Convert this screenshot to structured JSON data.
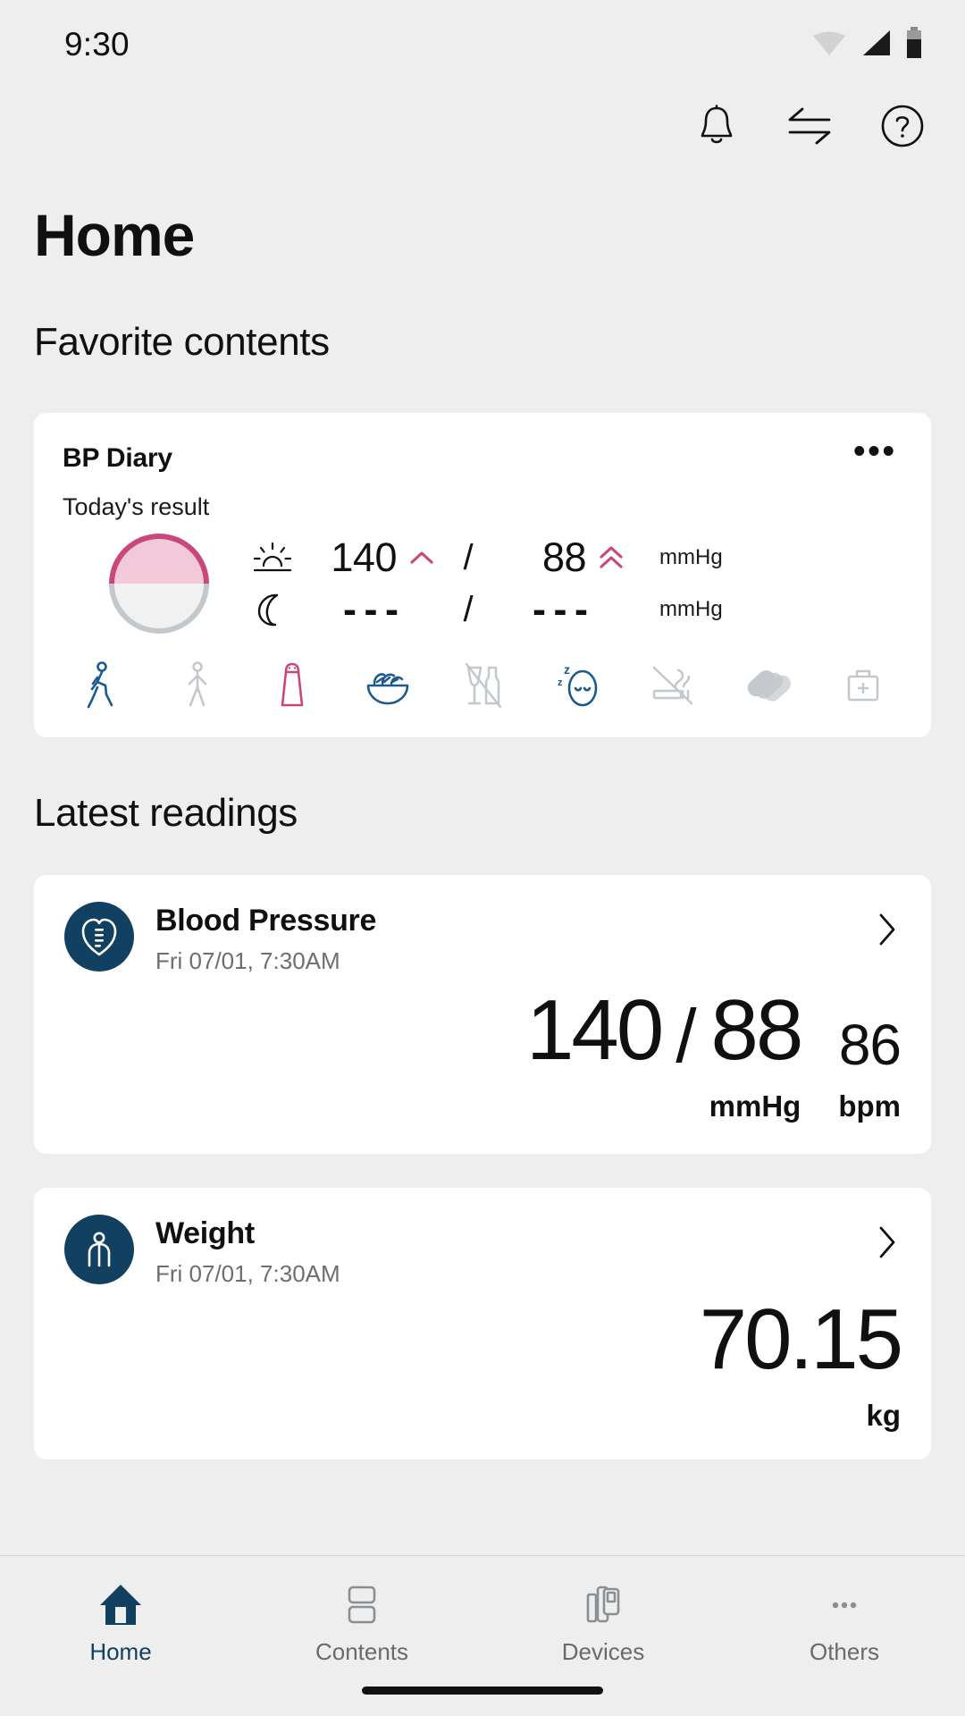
{
  "status_bar": {
    "time": "9:30",
    "icons": [
      "wifi-icon",
      "signal-icon",
      "battery-icon"
    ]
  },
  "header": {
    "title": "Home",
    "actions": [
      {
        "name": "notifications-icon",
        "label": "Notifications"
      },
      {
        "name": "transfer-icon",
        "label": "Transfer"
      },
      {
        "name": "help-icon",
        "label": "Help"
      }
    ]
  },
  "favorites": {
    "section_title": "Favorite contents",
    "bp_diary": {
      "title": "BP Diary",
      "subtitle": "Today's result",
      "more_label": "•••",
      "gauge": {
        "top_color": "#c8487c",
        "top_fill": "#f2c9d8",
        "bottom_color": "#c3c8cc",
        "bottom_fill": "#f1f1f1"
      },
      "rows": [
        {
          "period_icon": "sunrise-icon",
          "systolic": "140",
          "systolic_arrow": "chevron-up-single",
          "separator": "/",
          "diastolic": "88",
          "diastolic_arrow": "chevron-up-double",
          "unit": "mmHg"
        },
        {
          "period_icon": "moon-icon",
          "systolic": "- - -",
          "systolic_arrow": "",
          "separator": "/",
          "diastolic": "- - -",
          "diastolic_arrow": "",
          "unit": "mmHg"
        }
      ],
      "lifestyle_icons": [
        {
          "name": "exercise-icon",
          "state": "active-blue"
        },
        {
          "name": "walking-icon",
          "state": "inactive-gray"
        },
        {
          "name": "salt-shaker-icon",
          "state": "active-pink"
        },
        {
          "name": "salad-bowl-icon",
          "state": "active-blue"
        },
        {
          "name": "no-alcohol-icon",
          "state": "inactive-gray"
        },
        {
          "name": "sleep-icon",
          "state": "active-blue"
        },
        {
          "name": "no-smoking-icon",
          "state": "inactive-gray"
        },
        {
          "name": "pills-icon",
          "state": "inactive-gray"
        },
        {
          "name": "medical-kit-icon",
          "state": "inactive-gray"
        }
      ]
    }
  },
  "latest_readings": {
    "section_title": "Latest readings",
    "blood_pressure": {
      "title": "Blood Pressure",
      "timestamp": "Fri 07/01, 7:30AM",
      "badge_icon": "heart-monitor-icon",
      "chevron_icon": "chevron-right-icon",
      "systolic": "140",
      "separator": "/",
      "diastolic": "88",
      "unit": "mmHg",
      "pulse": "86",
      "pulse_unit": "bpm"
    },
    "weight": {
      "title": "Weight",
      "timestamp": "Fri 07/01, 7:30AM",
      "badge_icon": "person-icon",
      "chevron_icon": "chevron-right-icon",
      "value": "70.15",
      "unit": "kg"
    }
  },
  "bottom_nav": {
    "items": [
      {
        "label": "Home",
        "icon": "home-icon",
        "active": true
      },
      {
        "label": "Contents",
        "icon": "contents-icon",
        "active": false
      },
      {
        "label": "Devices",
        "icon": "devices-icon",
        "active": false
      },
      {
        "label": "Others",
        "icon": "more-dots-icon",
        "active": false
      }
    ]
  },
  "colors": {
    "background": "#eeeeee",
    "card": "#ffffff",
    "navy": "#114061",
    "pink": "#c8487c",
    "gray_icon": "#c3c8cc",
    "muted_text": "#6e6e6e"
  }
}
